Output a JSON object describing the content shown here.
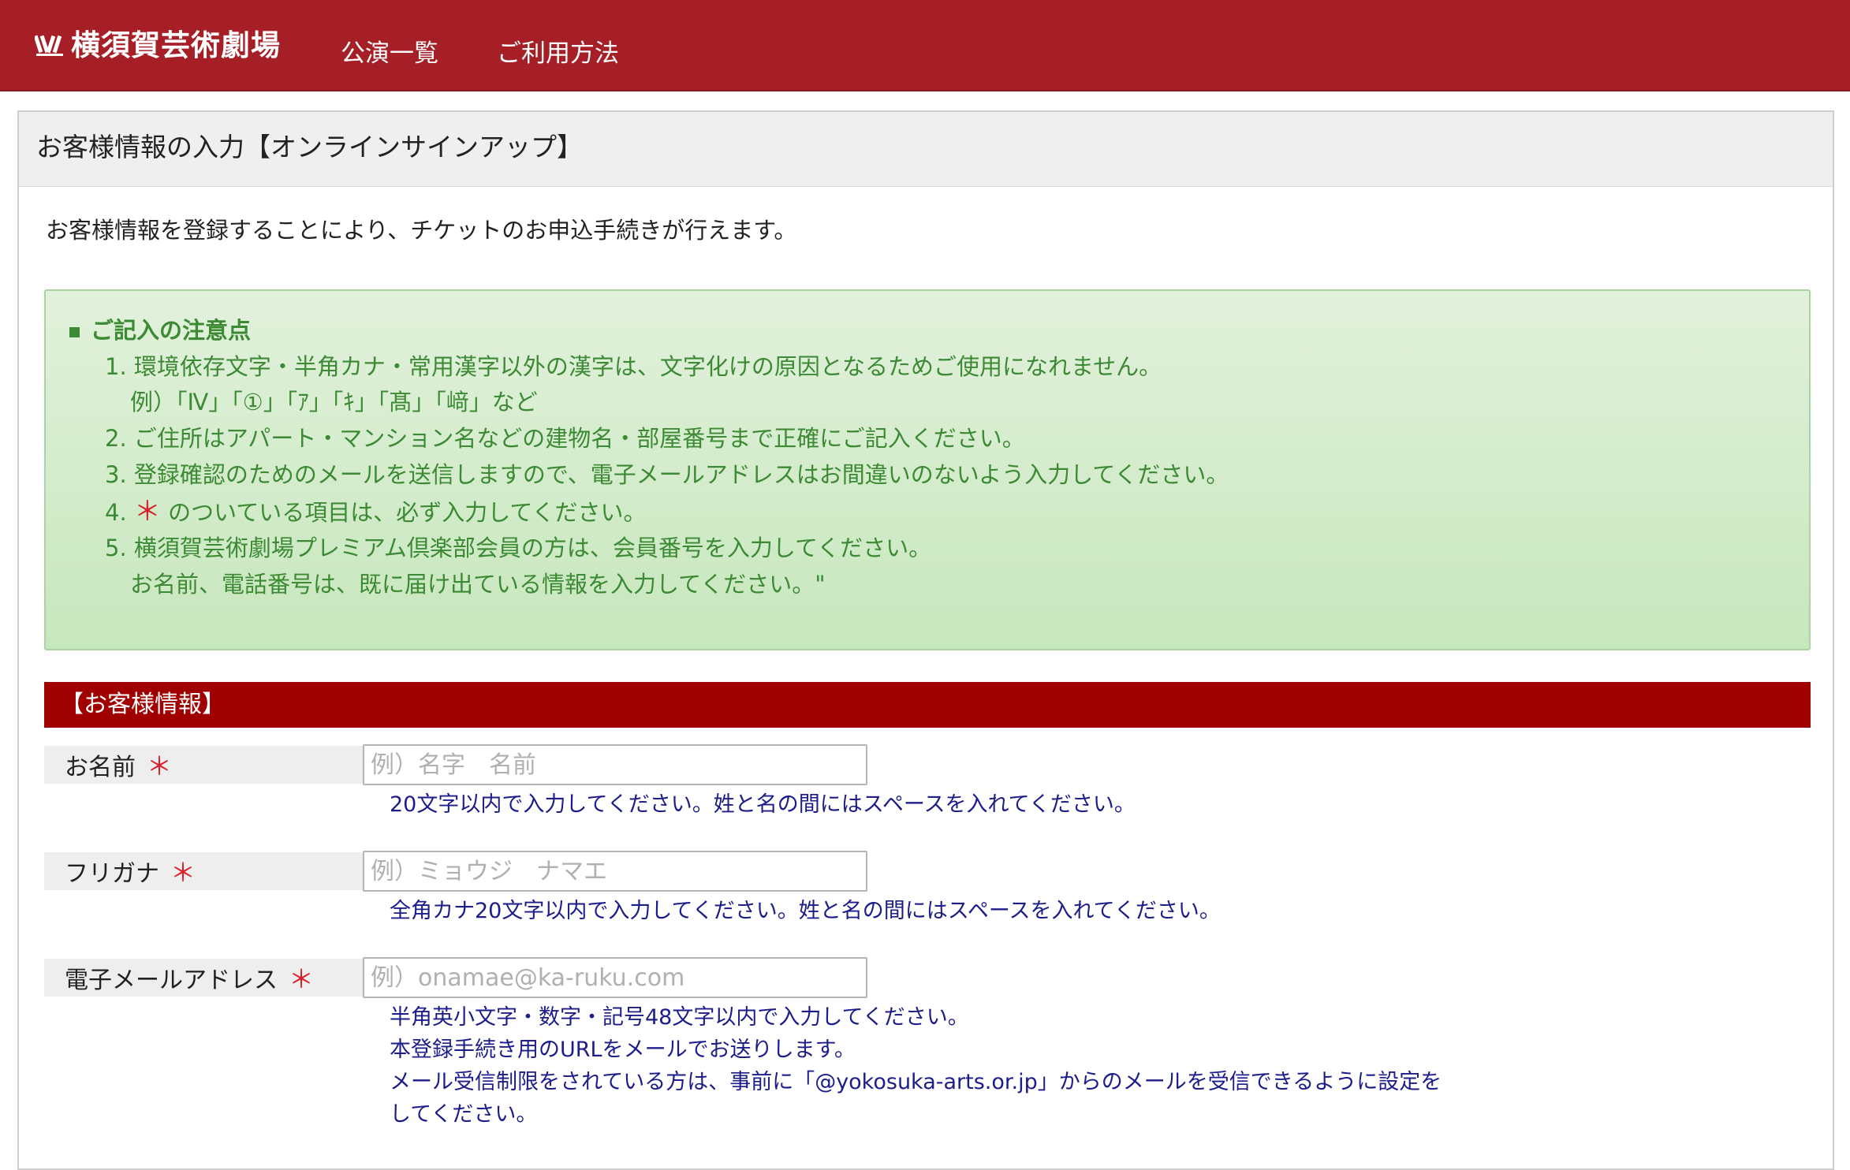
{
  "header": {
    "logo_text": "横須賀芸術劇場",
    "nav": [
      "公演一覧",
      "ご利用方法"
    ]
  },
  "page": {
    "title": "お客様情報の入力【オンラインサインアップ】",
    "intro": "お客様情報を登録することにより、チケットのお申込手続きが行えます。"
  },
  "notice": {
    "title": "ご記入の注意点",
    "line1": "1. 環境依存文字・半角カナ・常用漢字以外の漢字は、文字化けの原因となるためご使用になれません。",
    "line1b": "例）「Ⅳ」「①」「ｱ」「ｷ」「髙」「﨑」など",
    "line2": "2. ご住所はアパート・マンション名などの建物名・部屋番号まで正確にご記入ください。",
    "line3": "3. 登録確認のためのメールを送信しますので、電子メールアドレスはお間違いのないよう入力してください。",
    "line4_num": "4.",
    "line4_star": "＊",
    "line4_text": "のついている項目は、必ず入力してください。",
    "line5": "5. 横須賀芸術劇場プレミアム倶楽部会員の方は、会員番号を入力してください。",
    "line5b": "お名前、電話番号は、既に届け出ている情報を入力してください。\""
  },
  "section": {
    "title": "【お客様情報】"
  },
  "fields": {
    "name": {
      "label": "お名前",
      "required_mark": "＊",
      "placeholder": "例）名字　名前",
      "value": "",
      "hint": "20文字以内で入力してください。姓と名の間にはスペースを入れてください。"
    },
    "kana": {
      "label": "フリガナ",
      "required_mark": "＊",
      "placeholder": "例）ミョウジ　ナマエ",
      "value": "",
      "hint": "全角カナ20文字以内で入力してください。姓と名の間にはスペースを入れてください。"
    },
    "email": {
      "label": "電子メールアドレス",
      "required_mark": "＊",
      "placeholder": "例）onamae@ka-ruku.com",
      "value": "",
      "hint1": "半角英小文字・数字・記号48文字以内で入力してください。",
      "hint2": "本登録手続き用のURLをメールでお送りします。",
      "hint3": "メール受信制限をされている方は、事前に「@yokosuka-arts.or.jp」からのメールを受信できるように設定を",
      "hint4": "してください。"
    }
  },
  "colors": {
    "brand": "#a61e26",
    "section": "#a10000",
    "notice_text": "#3c8a33",
    "required": "#d91f2a",
    "hint_text": "#1c1c8a"
  }
}
